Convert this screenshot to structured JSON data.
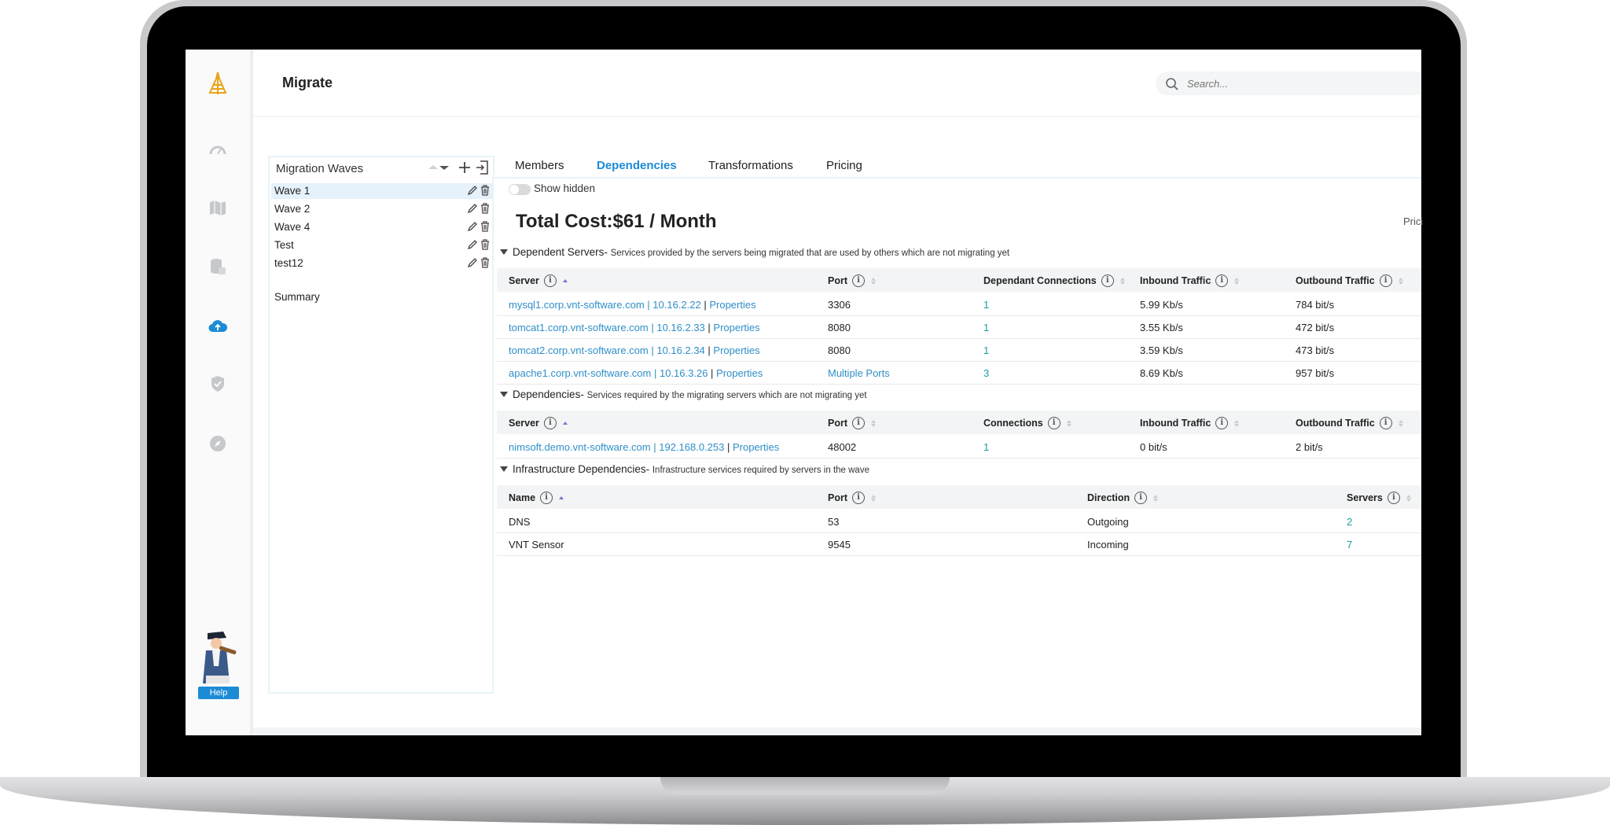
{
  "app": {
    "title": "Migrate",
    "search": {
      "placeholder": "Search..."
    },
    "help_label": "Help"
  },
  "sidebar": {
    "icons": [
      "logo-icon",
      "dashboard-icon",
      "map-icon",
      "database-icon",
      "cloud-upload-icon",
      "shield-icon",
      "compass-icon"
    ],
    "active": "cloud-upload-icon"
  },
  "waves": {
    "title": "Migration Waves",
    "items": [
      {
        "label": "Wave 1",
        "selected": true
      },
      {
        "label": "Wave 2"
      },
      {
        "label": "Wave 4"
      },
      {
        "label": "Test"
      },
      {
        "label": "test12"
      }
    ],
    "summary": "Summary"
  },
  "tabs": [
    {
      "label": "Members"
    },
    {
      "label": "Dependencies",
      "active": true
    },
    {
      "label": "Transformations"
    },
    {
      "label": "Pricing"
    }
  ],
  "show_hidden": "Show hidden",
  "total_cost": "Total Cost:$61 / Month",
  "pricing_cut": "Prici",
  "dependent_servers": {
    "title": "Dependent Servers-",
    "subtitle": "Services provided by the servers being migrated that are used by others which are not migrating yet",
    "columns": [
      "Server",
      "Port",
      "Dependant Connections",
      "Inbound Traffic",
      "Outbound Traffic"
    ],
    "rows": [
      {
        "host": "mysql1.corp.vnt-software.com",
        "ip": "10.16.2.22",
        "props": "Properties",
        "port": "3306",
        "conn": "1",
        "inbound": "5.99 Kb/s",
        "outbound": "784 bit/s"
      },
      {
        "host": "tomcat1.corp.vnt-software.com",
        "ip": "10.16.2.33",
        "props": "Properties",
        "port": "8080",
        "conn": "1",
        "inbound": "3.55 Kb/s",
        "outbound": "472 bit/s"
      },
      {
        "host": "tomcat2.corp.vnt-software.com",
        "ip": "10.16.2.34",
        "props": "Properties",
        "port": "8080",
        "conn": "1",
        "inbound": "3.59 Kb/s",
        "outbound": "473 bit/s"
      },
      {
        "host": "apache1.corp.vnt-software.com",
        "ip": "10.16.3.26",
        "props": "Properties",
        "port": "Multiple Ports",
        "conn": "3",
        "inbound": "8.69 Kb/s",
        "outbound": "957 bit/s"
      }
    ]
  },
  "dependencies": {
    "title": "Dependencies-",
    "subtitle": "Services required by the migrating servers which are not migrating yet",
    "columns": [
      "Server",
      "Port",
      "Connections",
      "Inbound Traffic",
      "Outbound Traffic"
    ],
    "rows": [
      {
        "host": "nimsoft.demo.vnt-software.com",
        "ip": "192.168.0.253",
        "props": "Properties",
        "port": "48002",
        "conn": "1",
        "inbound": "0 bit/s",
        "outbound": "2 bit/s"
      }
    ]
  },
  "infrastructure": {
    "title": "Infrastructure Dependencies-",
    "subtitle": "Infrastructure services required by servers in the wave",
    "columns": [
      "Name",
      "Port",
      "Direction",
      "Servers"
    ],
    "rows": [
      {
        "name": "DNS",
        "port": "53",
        "direction": "Outgoing",
        "servers": "2"
      },
      {
        "name": "VNT Sensor",
        "port": "9545",
        "direction": "Incoming",
        "servers": "7"
      }
    ]
  },
  "colors": {
    "accent": "#1b8bd6",
    "link": "#2f8fc7",
    "logo": "#e8a317"
  }
}
